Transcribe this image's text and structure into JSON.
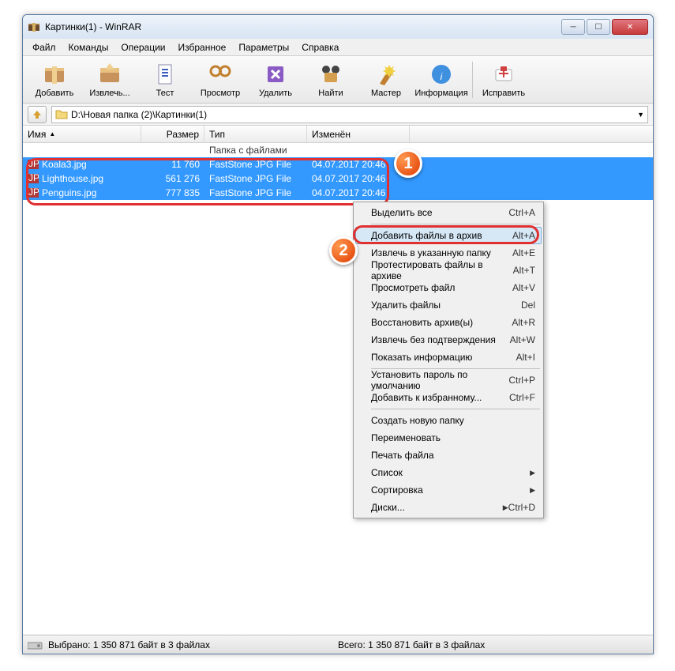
{
  "title": "Картинки(1) - WinRAR",
  "menubar": [
    "Файл",
    "Команды",
    "Операции",
    "Избранное",
    "Параметры",
    "Справка"
  ],
  "toolbar": [
    {
      "label": "Добавить",
      "icon": "add"
    },
    {
      "label": "Извлечь...",
      "icon": "extract"
    },
    {
      "label": "Тест",
      "icon": "test"
    },
    {
      "label": "Просмотр",
      "icon": "view"
    },
    {
      "label": "Удалить",
      "icon": "delete"
    },
    {
      "label": "Найти",
      "icon": "find"
    },
    {
      "label": "Мастер",
      "icon": "wizard"
    },
    {
      "label": "Информация",
      "icon": "info"
    },
    {
      "label": "Исправить",
      "icon": "repair"
    }
  ],
  "address": "D:\\Новая папка (2)\\Картинки(1)",
  "columns": {
    "name": "Имя",
    "size": "Размер",
    "type": "Тип",
    "modified": "Изменён"
  },
  "parent_row_type": "Папка с файлами",
  "files": [
    {
      "name": "Koala3.jpg",
      "size": "11 760",
      "type": "FastStone JPG File",
      "modified": "04.07.2017 20:46"
    },
    {
      "name": "Lighthouse.jpg",
      "size": "561 276",
      "type": "FastStone JPG File",
      "modified": "04.07.2017 20:46"
    },
    {
      "name": "Penguins.jpg",
      "size": "777 835",
      "type": "FastStone JPG File",
      "modified": "04.07.2017 20:46"
    }
  ],
  "context_menu": [
    {
      "label": "Выделить все",
      "shortcut": "Ctrl+A"
    },
    {
      "sep": true
    },
    {
      "label": "Добавить файлы в архив",
      "shortcut": "Alt+A",
      "hover": true
    },
    {
      "label": "Извлечь в указанную папку",
      "shortcut": "Alt+E"
    },
    {
      "label": "Протестировать файлы в архиве",
      "shortcut": "Alt+T"
    },
    {
      "label": "Просмотреть файл",
      "shortcut": "Alt+V"
    },
    {
      "label": "Удалить файлы",
      "shortcut": "Del"
    },
    {
      "label": "Восстановить архив(ы)",
      "shortcut": "Alt+R"
    },
    {
      "label": "Извлечь без подтверждения",
      "shortcut": "Alt+W"
    },
    {
      "label": "Показать информацию",
      "shortcut": "Alt+I"
    },
    {
      "sep": true
    },
    {
      "label": "Установить пароль по умолчанию",
      "shortcut": "Ctrl+P"
    },
    {
      "label": "Добавить к избранному...",
      "shortcut": "Ctrl+F"
    },
    {
      "sep": true
    },
    {
      "label": "Создать новую папку",
      "shortcut": ""
    },
    {
      "label": "Переименовать",
      "shortcut": ""
    },
    {
      "label": "Печать файла",
      "shortcut": ""
    },
    {
      "label": "Список",
      "shortcut": "",
      "submenu": true
    },
    {
      "label": "Сортировка",
      "shortcut": "",
      "submenu": true
    },
    {
      "label": "Диски...",
      "shortcut": "Ctrl+D",
      "submenu": true
    }
  ],
  "status": {
    "left": "Выбрано: 1 350 871 байт в 3 файлах",
    "right": "Всего: 1 350 871 байт в 3 файлах"
  },
  "badges": {
    "one": "1",
    "two": "2"
  }
}
